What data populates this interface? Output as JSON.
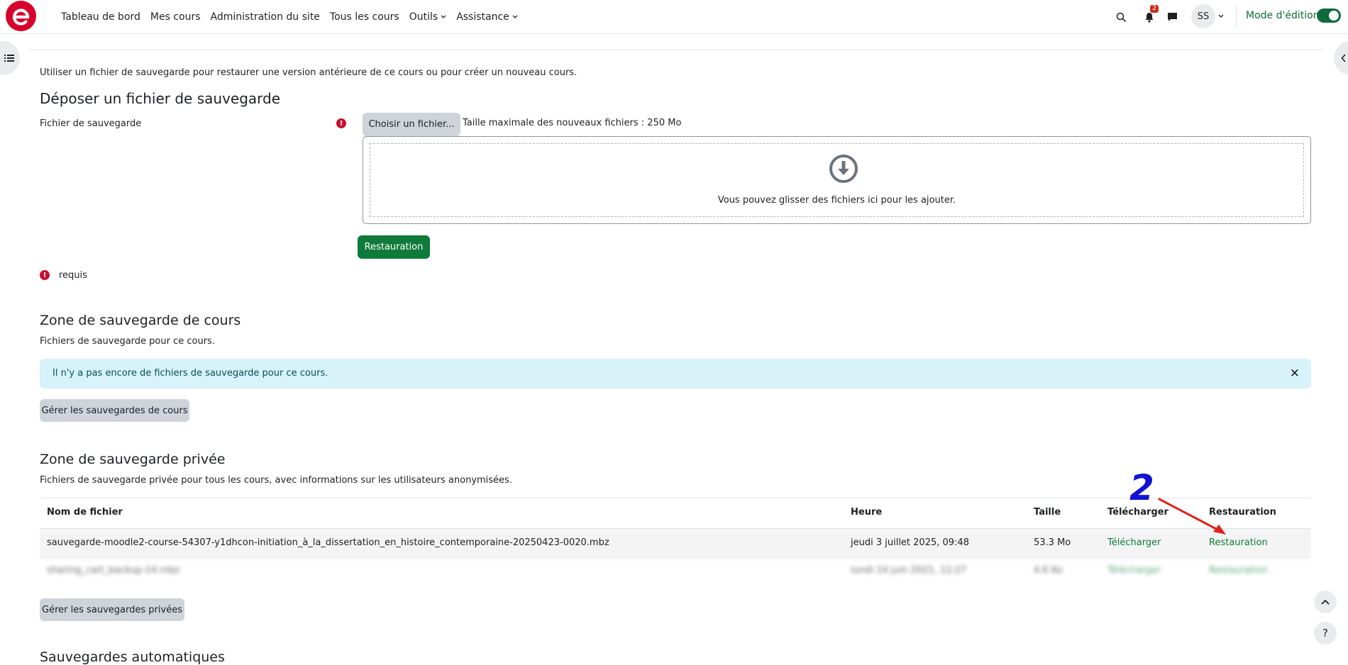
{
  "colors": {
    "brand": "#d6002b",
    "accent_green": "#0f7b3a",
    "alert_bg": "#d7f2f8",
    "required": "#c7102e",
    "annotation": "#1212d6",
    "annotation_arrow": "#e0221b"
  },
  "navbar": {
    "logo_icon": "brand-e-logo",
    "items": [
      {
        "label": "Tableau de bord"
      },
      {
        "label": "Mes cours"
      },
      {
        "label": "Administration du site"
      },
      {
        "label": "Tous les cours"
      },
      {
        "label": "Outils"
      },
      {
        "label": "Assistance"
      }
    ],
    "notification_count": "2",
    "user_initials": "SS",
    "edit_mode_label": "Mode d'édition",
    "edit_mode_on": true
  },
  "page": {
    "intro": "Utiliser un fichier de sauvegarde pour restaurer une version antérieure de ce cours ou pour créer un nouveau cours.",
    "upload": {
      "heading": "Déposer un fichier de sauvegarde",
      "field_label": "Fichier de sauvegarde",
      "choose_button": "Choisir un fichier...",
      "max_size": "Taille maximale des nouveaux fichiers : 250 Mo",
      "dropzone_text": "Vous pouvez glisser des fichiers ici pour les ajouter.",
      "submit": "Restauration",
      "required_text": "requis"
    },
    "course_zone": {
      "heading": "Zone de sauvegarde de cours",
      "subtitle": "Fichiers de sauvegarde pour ce cours.",
      "alert": "Il n'y a pas encore de fichiers de sauvegarde pour ce cours.",
      "manage_button": "Gérer les sauvegardes de cours"
    },
    "private_zone": {
      "heading": "Zone de sauvegarde privée",
      "subtitle": "Fichiers de sauvegarde privée pour tous les cours, avec informations sur les utilisateurs anonymisées.",
      "columns": [
        "Nom de fichier",
        "Heure",
        "Taille",
        "Télécharger",
        "Restauration"
      ],
      "rows": [
        {
          "filename": "sauvegarde-moodle2-course-54307-y1dhcon-initiation_à_la_dissertation_en_histoire_contemporaine-20250423-0020.mbz",
          "time": "jeudi 3 juillet 2025, 09:48",
          "size": "53.3 Mo",
          "download": "Télécharger",
          "restore": "Restauration"
        },
        {
          "filename": "sharing_cart_backup-14.mbz",
          "time": "lundi 14 juin 2021, 12:27",
          "size": "4.6 Ko",
          "download": "Télécharger",
          "restore": "Restauration"
        }
      ],
      "manage_button": "Gérer les sauvegardes privées"
    },
    "auto_heading": "Sauvegardes automatiques"
  },
  "annotation": {
    "number": "2"
  }
}
